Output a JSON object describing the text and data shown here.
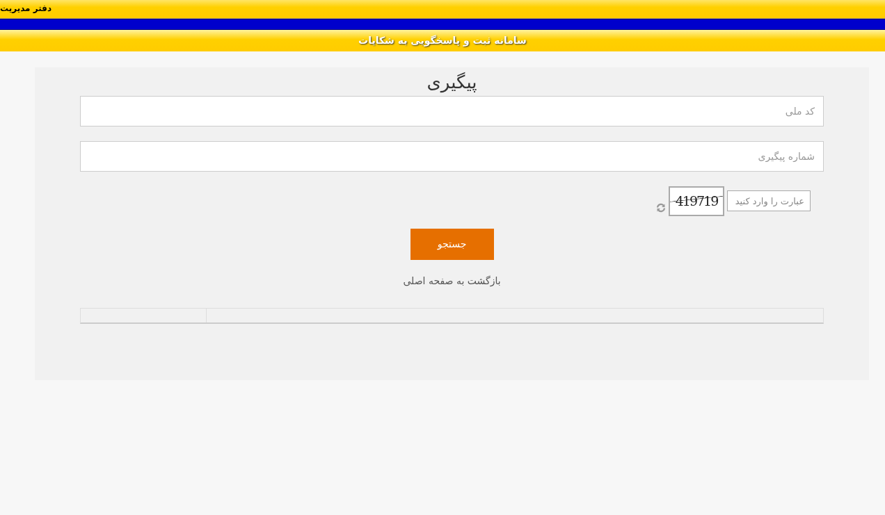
{
  "top_bar": {
    "text": "دفتر مدیریت"
  },
  "header": {
    "title": "سامانه ثبت و پاسخگویی به شکایات"
  },
  "form": {
    "title": "پیگیری",
    "fields": [
      {
        "placeholder": "کد ملی"
      },
      {
        "placeholder": "شماره پیگیری"
      }
    ],
    "captcha": {
      "placeholder": "عبارت را وارد کنید",
      "code": "419719"
    },
    "search_button": "جستجو",
    "back_link": "بازگشت به صفحه اصلی"
  }
}
